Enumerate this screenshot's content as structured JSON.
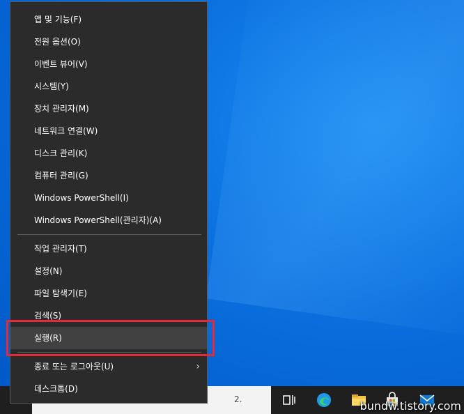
{
  "menu": {
    "items": [
      {
        "label": "앱 및 기능(F)"
      },
      {
        "label": "전원 옵션(O)"
      },
      {
        "label": "이벤트 뷰어(V)"
      },
      {
        "label": "시스템(Y)"
      },
      {
        "label": "장치 관리자(M)"
      },
      {
        "label": "네트워크 연결(W)"
      },
      {
        "label": "디스크 관리(K)"
      },
      {
        "label": "컴퓨터 관리(G)"
      },
      {
        "label": "Windows PowerShell(I)"
      },
      {
        "label": "Windows PowerShell(관리자)(A)"
      },
      {
        "label": "작업 관리자(T)"
      },
      {
        "label": "설정(N)"
      },
      {
        "label": "파일 탐색기(E)"
      },
      {
        "label": "검색(S)"
      },
      {
        "label": "실행(R)"
      },
      {
        "label": "종료 또는 로그아웃(U)"
      },
      {
        "label": "데스크톱(D)"
      }
    ],
    "submenu_chevron": "›"
  },
  "taskbar": {
    "search_partial": "2.",
    "watermark": "bundw.tistory.com"
  },
  "colors": {
    "menu_bg": "#2b2b2b",
    "hover_bg": "#414141",
    "highlight": "#e12b3a",
    "desktop": "#0a6fde"
  }
}
